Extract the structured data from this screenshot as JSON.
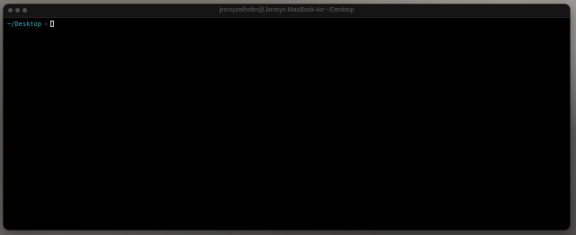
{
  "window": {
    "title": "jimmyzelhofer@Jimmys-MacBook-Air:~/Desktop"
  },
  "prompt": {
    "path": "~/Desktop",
    "symbol": "›"
  },
  "colors": {
    "path": "#2fb3c9",
    "prompt_symbol": "#e0457b",
    "terminal_background": "#000000"
  },
  "icons": {
    "traffic_lights": [
      "close-icon",
      "minimize-icon",
      "zoom-icon"
    ],
    "cursor": "block-cursor-icon"
  }
}
